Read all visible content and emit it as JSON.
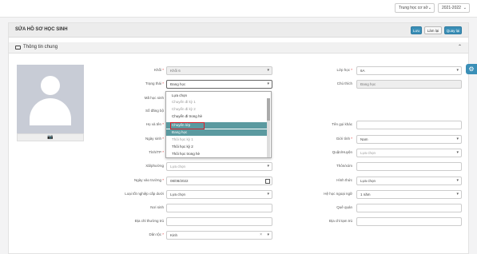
{
  "topbar": {
    "level": "Trung học cơ sở",
    "year": "2021-2022"
  },
  "header": {
    "title": "SỬA HỒ SƠ HỌC SINH",
    "btn_save": "Lưu",
    "btn_reset": "Làm lại",
    "btn_back": "Quay lại"
  },
  "section": {
    "title": "Thông tin chung"
  },
  "colors": {
    "primary": "#3a8fb7",
    "highlight": "#5b9aa0",
    "marker": "#d8202a"
  },
  "left": {
    "khoi_label": "Khối",
    "khoi_value": "Khối 6",
    "trangthai_label": "Trạng thái",
    "trangthai_value": "Đang học",
    "mahs_label": "Mã học sinh",
    "sodangbo_label": "Số đăng bộ",
    "hoten_label": "Họ và tên",
    "ngaysinh_label": "Ngày sinh",
    "tinh_label": "Tỉnh/TP",
    "xa_label": "Xã/phường",
    "xa_value": "Lựa chọn",
    "ngayvaotruong_label": "Ngày vào trường",
    "ngayvaotruong_value": "08/08/2022",
    "loaitotnghiep_label": "Loại tốt nghiệp cấp dưới",
    "loaitotnghiep_value": "Lựa chọn",
    "noisinh_label": "Nơi sinh",
    "diachithuongtru_label": "Địa chỉ thường trú",
    "dantoc_label": "Dân tộc",
    "dantoc_value": "Kinh"
  },
  "right": {
    "lophoc_label": "Lớp học",
    "lophoc_value": "6A",
    "chuthich_label": "Chú thích",
    "chuthich_value": "Đang học",
    "tengoikhac_label": "Tên gọi khác",
    "gioitinh_label": "Giới tính",
    "gioitinh_value": "Nam",
    "quanhuyen_label": "Quận/Huyện",
    "quanhuyen_value": "Lựa chọn",
    "thonxom_label": "Thôn/xóm",
    "hinhthuc_label": "Hình thức",
    "hinhthuc_value": "Lựa chọn",
    "hengoaingu_label": "Hệ học ngoại ngữ",
    "hengoaingu_value": "1 năm",
    "quequan_label": "Quê quán",
    "diachitamtru_label": "Địa chỉ tạm trú"
  },
  "dropdown": {
    "items": [
      "Lựa chọn",
      "Chuyển đi kỳ 1",
      "Chuyển đi kỳ 2",
      "Chuyển đi trong hè",
      "Chuyển lớp",
      "Đang học",
      "Thôi học kỳ 1",
      "Thôi học kỳ 2",
      "Thôi học trong hè"
    ]
  }
}
